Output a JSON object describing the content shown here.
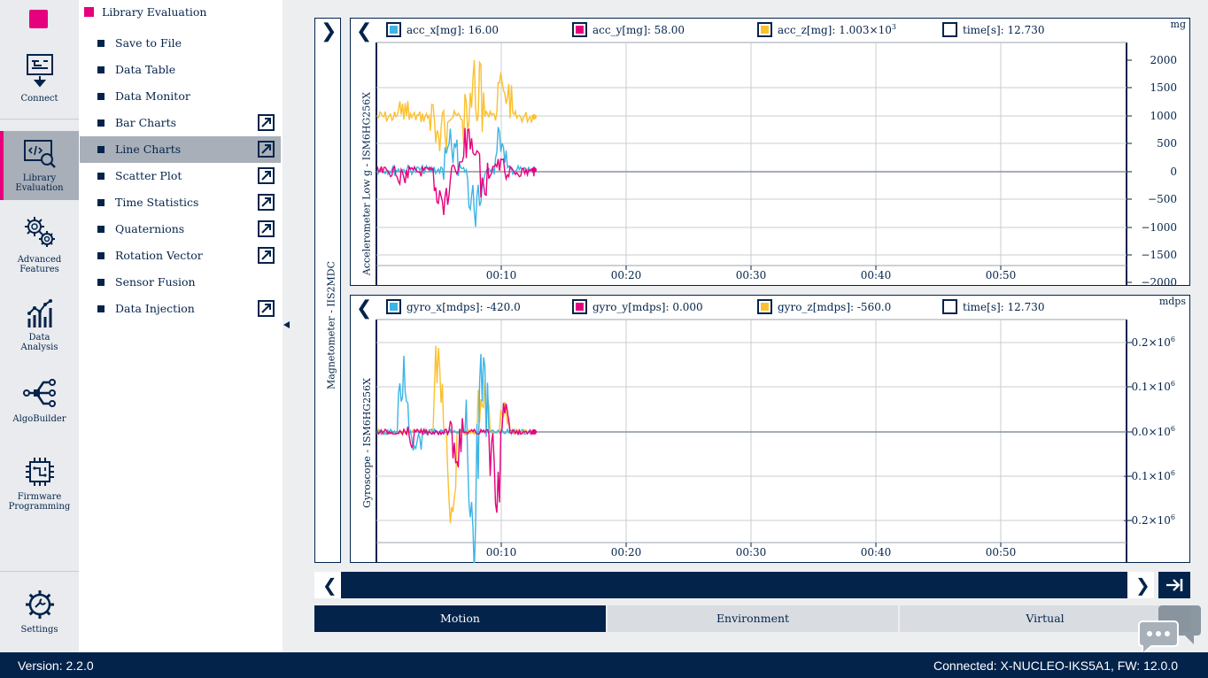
{
  "app": {
    "version_label": "Version: 2.2.0",
    "status_label": "Connected:  X-NUCLEO-IKS5A1, FW: 12.0.0",
    "accent": "#e6007e",
    "navy": "#03234b"
  },
  "rail": [
    {
      "label": "Connect",
      "icon": "connect-icon"
    },
    {
      "label": "Library\nEvaluation",
      "icon": "code-search-icon",
      "active": true
    },
    {
      "label": "Advanced\nFeatures",
      "icon": "gears-icon"
    },
    {
      "label": "Data\nAnalysis",
      "icon": "analytics-icon"
    },
    {
      "label": "AlgoBuilder",
      "icon": "flow-icon"
    },
    {
      "label": "Firmware\nProgramming",
      "icon": "chip-icon"
    },
    {
      "label": "Settings",
      "icon": "settings-icon"
    }
  ],
  "panel": {
    "title": "Library Evaluation",
    "items": [
      {
        "label": "Save to File",
        "external": false
      },
      {
        "label": "Data Table",
        "external": false
      },
      {
        "label": "Data Monitor",
        "external": false
      },
      {
        "label": "Bar Charts",
        "external": true
      },
      {
        "label": "Line Charts",
        "external": true,
        "active": true
      },
      {
        "label": "Scatter Plot",
        "external": true
      },
      {
        "label": "Time Statistics",
        "external": true
      },
      {
        "label": "Quaternions",
        "external": true
      },
      {
        "label": "Rotation Vector",
        "external": true
      },
      {
        "label": "Sensor Fusion",
        "external": false
      },
      {
        "label": "Data Injection",
        "external": true
      }
    ]
  },
  "magnetometer_label": "Magnetometer - IIS2MDC",
  "charts": {
    "accel": {
      "title": "Accelerometer Low g - ISM6HG256X",
      "unit": "mg",
      "legend": [
        {
          "name": "acc_x[mg]",
          "value": "16.00",
          "color": "#3cb4e6"
        },
        {
          "name": "acc_y[mg]",
          "value": "58.00",
          "color": "#e6007e"
        },
        {
          "name": "acc_z[mg]",
          "value": "1.003×10",
          "exp": "3",
          "color": "#ffd200"
        },
        {
          "name": "time[s]",
          "value": "12.730",
          "color": "#ffffff"
        }
      ],
      "yticks": [
        "2000",
        "1500",
        "1000",
        "500",
        "0",
        "−500",
        "−1000",
        "−1500",
        "−2000"
      ],
      "xticks": [
        "00:10",
        "00:20",
        "00:30",
        "00:40",
        "00:50"
      ]
    },
    "gyro": {
      "title": "Gyroscope - ISM6HG256X",
      "unit": "mdps",
      "legend": [
        {
          "name": "gyro_x[mdps]",
          "value": "-420.0",
          "color": "#3cb4e6"
        },
        {
          "name": "gyro_y[mdps]",
          "value": "0.000",
          "color": "#e6007e"
        },
        {
          "name": "gyro_z[mdps]",
          "value": "-560.0",
          "color": "#ffd200"
        },
        {
          "name": "time[s]",
          "value": "12.730",
          "color": "#ffffff"
        }
      ],
      "yticks": [
        {
          "m": "0.2×10",
          "e": "6"
        },
        {
          "m": "0.1×10",
          "e": "6"
        },
        {
          "m": "0.0×10",
          "e": "6"
        },
        {
          "m": "−0.1×10",
          "e": "6"
        },
        {
          "m": "−0.2×10",
          "e": "6"
        }
      ],
      "xticks": [
        "00:10",
        "00:20",
        "00:30",
        "00:40",
        "00:50"
      ]
    }
  },
  "tabs": [
    {
      "label": "Motion",
      "active": true
    },
    {
      "label": "Environment",
      "active": false
    },
    {
      "label": "Virtual",
      "active": false
    }
  ]
}
